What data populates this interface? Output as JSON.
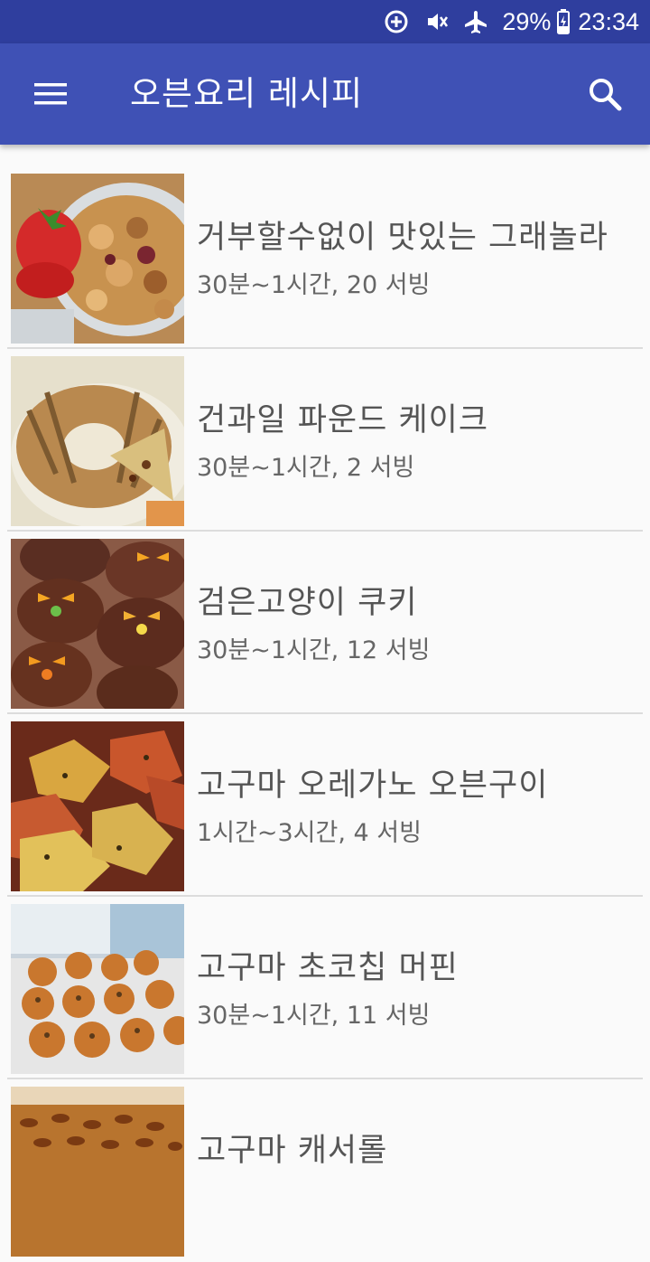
{
  "status_bar": {
    "battery_percent": "29%",
    "time": "23:34",
    "icons": [
      "data-saver-icon",
      "vibrate-mute-icon",
      "airplane-icon",
      "battery-charging-icon"
    ]
  },
  "app_bar": {
    "title": "오븐요리 레시피",
    "menu_icon": "hamburger-menu-icon",
    "search_icon": "search-icon",
    "background": "#3f51b5",
    "status_background": "#2f3e9e"
  },
  "recipes": [
    {
      "name": "거부할수없이 맛있는 그래놀라",
      "meta": "30분~1시간, 20 서빙",
      "image": "granola-photo"
    },
    {
      "name": "건과일 파운드 케이크",
      "meta": "30분~1시간, 2 서빙",
      "image": "pound-cake-photo"
    },
    {
      "name": "검은고양이 쿠키",
      "meta": "30분~1시간, 12 서빙",
      "image": "black-cat-cookies-photo"
    },
    {
      "name": "고구마 오레가노 오븐구이",
      "meta": "1시간~3시간, 4 서빙",
      "image": "roasted-sweet-potato-photo"
    },
    {
      "name": "고구마 초코칩 머핀",
      "meta": "30분~1시간, 11 서빙",
      "image": "sweet-potato-muffin-photo"
    },
    {
      "name": "고구마 캐서롤",
      "meta": "",
      "image": "sweet-potato-casserole-photo"
    }
  ]
}
